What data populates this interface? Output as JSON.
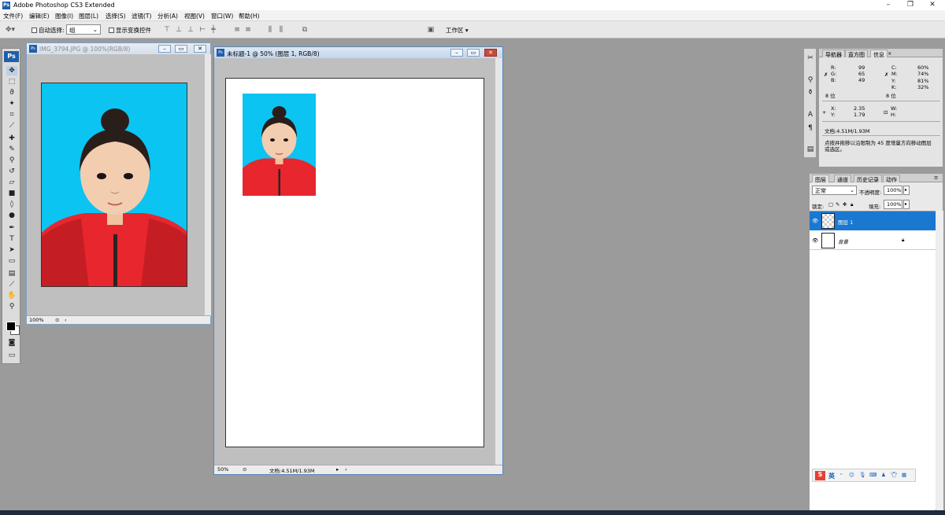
{
  "app": {
    "title": "Adobe Photoshop CS3 Extended",
    "icon": "ps-app-icon"
  },
  "window_controls": {
    "minimize": "–",
    "restore": "❐",
    "close": "✕"
  },
  "menu": [
    "文件(F)",
    "编辑(E)",
    "图像(I)",
    "图层(L)",
    "选择(S)",
    "滤镜(T)",
    "分析(A)",
    "视图(V)",
    "窗口(W)",
    "帮助(H)"
  ],
  "options": {
    "auto_select_label": "自动选择:",
    "auto_select_value": "组",
    "show_transform_label": "显示变换控件",
    "workspace_label": "工作区 ▾"
  },
  "toolbox": {
    "logo": "Ps"
  },
  "doc1": {
    "title": "IMG_3794.JPG @ 100%(RGB/8)",
    "zoom": "100%"
  },
  "doc2": {
    "title": "未标题-1 @ 50% (图层 1, RGB/8)",
    "zoom": "50%",
    "doc_info": "文档:4.51M/1.93M"
  },
  "info_panel": {
    "tabs": [
      "导航器",
      "直方图",
      "信息"
    ],
    "rgb": {
      "R": "99",
      "G": "65",
      "B": "49"
    },
    "cmyk": {
      "C": "60%",
      "M": "74%",
      "Y": "81%",
      "K": "32%"
    },
    "bits_left": "8 位",
    "bits_right": "8 位",
    "xy": {
      "X": "2.35",
      "Y": "1.79"
    },
    "wh": {
      "W": "",
      "H": ""
    },
    "doc_info": "文档:4.51M/1.93M",
    "hint": "点按并拖移以沿限制为 45 度增量方向移动图层或选区。"
  },
  "layers_panel": {
    "tabs": [
      "图层",
      "通道",
      "历史记录",
      "动作"
    ],
    "blend_mode": "正常",
    "opacity_label": "不透明度:",
    "opacity": "100%",
    "lock_label": "锁定:",
    "fill_label": "填充:",
    "fill": "100%",
    "layers": [
      {
        "name": "图层 1",
        "selected": true
      },
      {
        "name": "背景",
        "selected": false
      }
    ]
  },
  "ime": {
    "logo": "S",
    "label": "英"
  },
  "colors": {
    "accent": "#1f5fa8",
    "photo_bg": "#0cc4f2",
    "jacket": "#e8262d",
    "selected_layer": "#1a78d0"
  }
}
